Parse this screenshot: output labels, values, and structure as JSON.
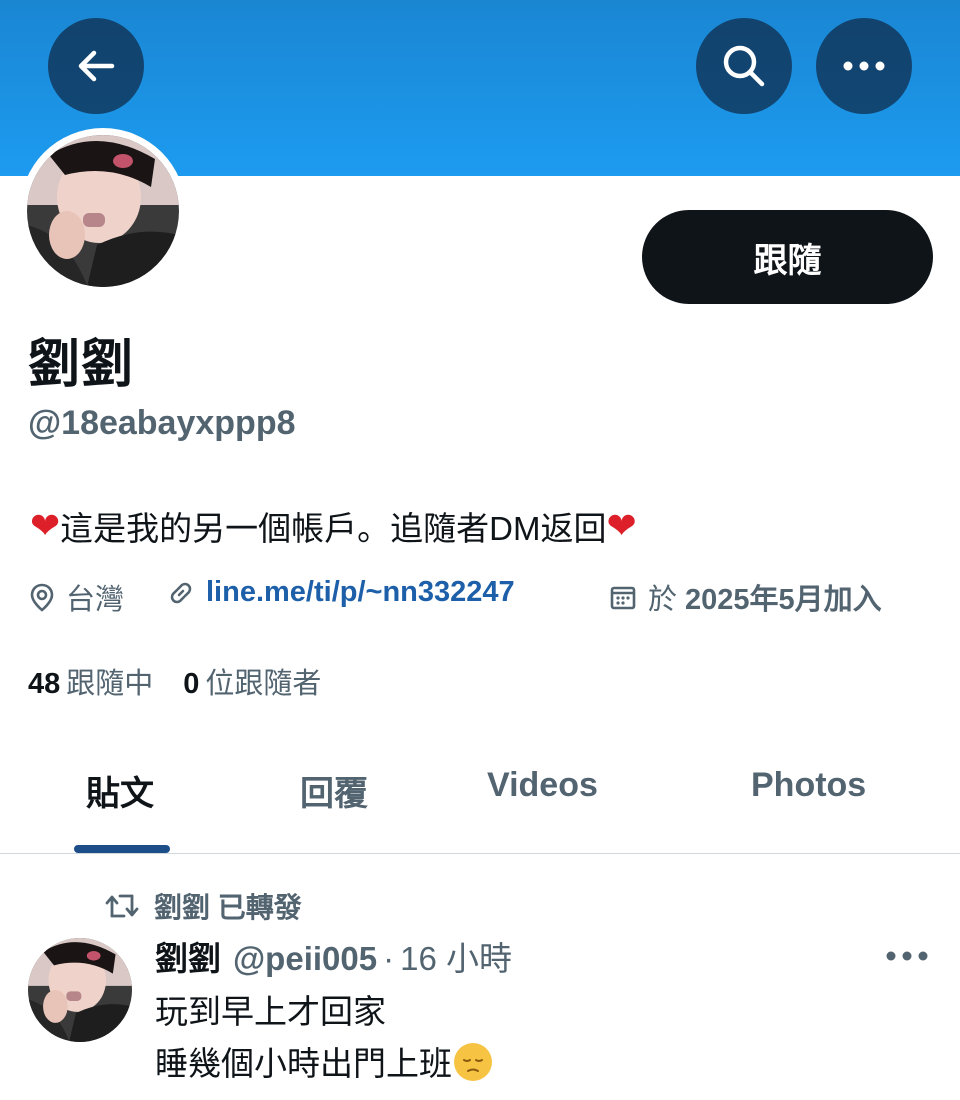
{
  "header": {
    "back_icon": "arrow-left-icon",
    "search_icon": "search-icon",
    "more_icon": "more-horizontal-icon",
    "banner_color": "#1d9bf0"
  },
  "profile": {
    "follow_label": "跟隨",
    "display_name": "劉劉",
    "handle": "@18eabayxppp8",
    "bio_text": "這是我的另一個帳戶。追隨者DM返回",
    "bio_heart": "❤",
    "location": "台灣",
    "link": "line.me/ti/p/~nn332247",
    "joined_prefix": "於",
    "joined_date": "2025年5月加入",
    "following_count": "48",
    "following_label": "跟隨中",
    "followers_count": "0",
    "followers_label": "位跟隨者"
  },
  "tabs": {
    "posts": "貼文",
    "replies": "回覆",
    "videos": "Videos",
    "photos": "Photos"
  },
  "post": {
    "repost_text": "劉劉 已轉發",
    "author_name": "劉劉",
    "author_handle": "@peii005",
    "separator": "·",
    "time": "16 小時",
    "line1": "玩到早上才回家",
    "line2": "睡幾個小時出門上班"
  },
  "colors": {
    "accent": "#1d9bf0",
    "link": "#1d5fa8",
    "text_primary": "#0f1419",
    "text_secondary": "#536471",
    "follow_button": "#0f1419"
  }
}
